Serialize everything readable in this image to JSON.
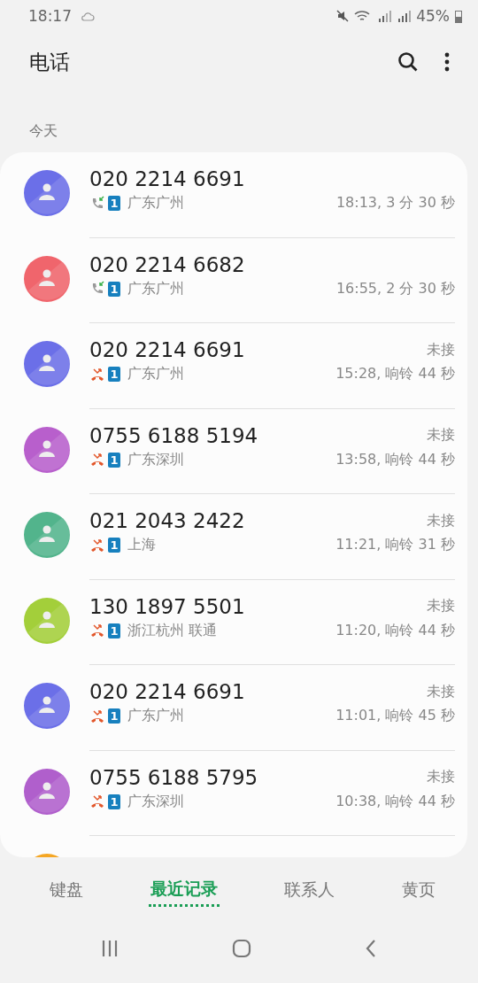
{
  "status_bar": {
    "time": "18:17",
    "battery": "45%"
  },
  "app_bar": {
    "title": "电话"
  },
  "section": {
    "label": "今天"
  },
  "calls": [
    {
      "number": "020 2214 6691",
      "kind": "incoming",
      "sim": "1",
      "location": "广东广州",
      "detail": "18:13, 3 分 30 秒",
      "color": "#6b6fe8"
    },
    {
      "number": "020 2214 6682",
      "kind": "incoming",
      "sim": "1",
      "location": "广东广州",
      "detail": "16:55, 2 分 30 秒",
      "color": "#f0656c"
    },
    {
      "number": "020 2214 6691",
      "kind": "missed",
      "status": "未接",
      "sim": "1",
      "location": "广东广州",
      "detail": "15:28, 响铃 44 秒",
      "color": "#6b6fe8"
    },
    {
      "number": "0755 6188 5194",
      "kind": "missed",
      "status": "未接",
      "sim": "1",
      "location": "广东深圳",
      "detail": "13:58, 响铃 44 秒",
      "color": "#b85fcc"
    },
    {
      "number": "021 2043 2422",
      "kind": "missed",
      "status": "未接",
      "sim": "1",
      "location": "上海",
      "detail": "11:21, 响铃 31 秒",
      "color": "#52b48c"
    },
    {
      "number": "130 1897 5501",
      "kind": "missed",
      "status": "未接",
      "sim": "1",
      "location": "浙江杭州 联通",
      "detail": "11:20, 响铃 44 秒",
      "color": "#a3cf3a"
    },
    {
      "number": "020 2214 6691",
      "kind": "missed",
      "status": "未接",
      "sim": "1",
      "location": "广东广州",
      "detail": "11:01, 响铃 45 秒",
      "color": "#6b6fe8"
    },
    {
      "number": "0755 6188 5795",
      "kind": "missed",
      "status": "未接",
      "sim": "1",
      "location": "广东深圳",
      "detail": "10:38, 响铃 44 秒",
      "color": "#b05fcc"
    },
    {
      "kind": "partial",
      "color": "#f5a623"
    }
  ],
  "tabs": [
    {
      "label": "键盘",
      "selected": false
    },
    {
      "label": "最近记录",
      "selected": true
    },
    {
      "label": "联系人",
      "selected": false
    },
    {
      "label": "黄页",
      "selected": false
    }
  ]
}
